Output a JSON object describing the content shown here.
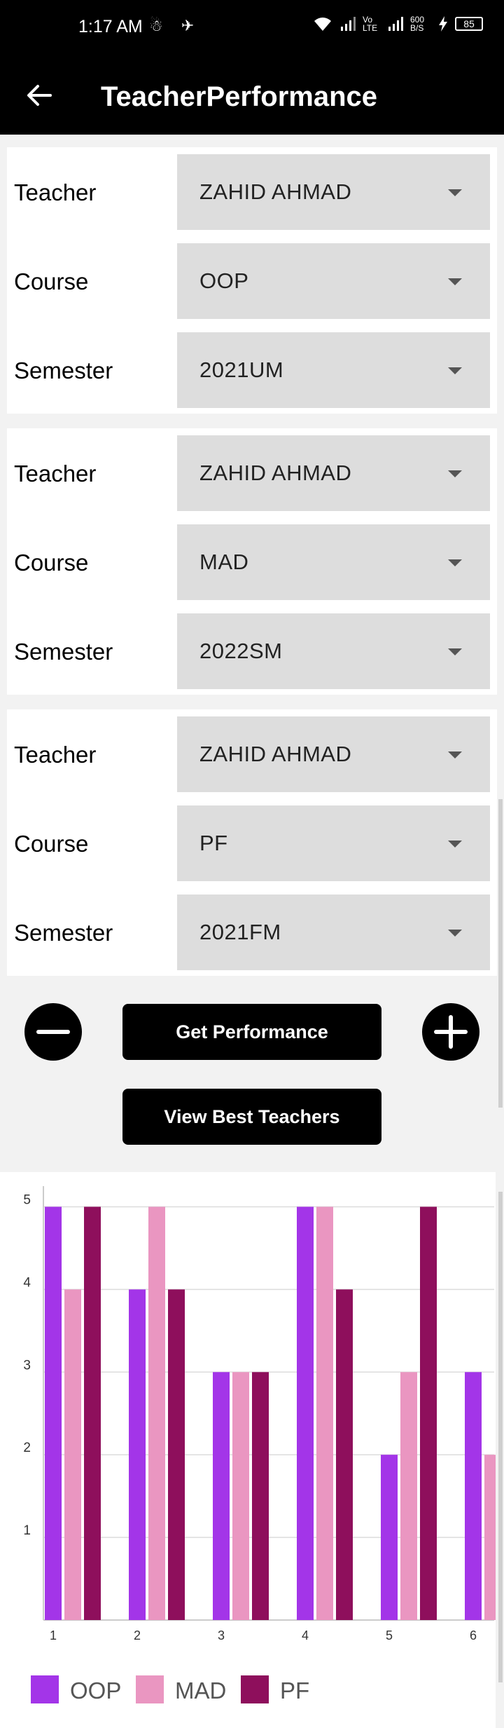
{
  "status_bar": {
    "time": "1:17 AM",
    "left_icons": "☃ ✈",
    "network": "Vo LTE",
    "speed": "600 B/S",
    "battery": "85"
  },
  "app_bar": {
    "title": "TeacherPerformance",
    "back_icon": "arrow-left-icon"
  },
  "cards": [
    {
      "teacher_label": "Teacher",
      "teacher": "ZAHID  AHMAD",
      "course_label": "Course",
      "course": "OOP",
      "semester_label": "Semester",
      "semester": "2021UM"
    },
    {
      "teacher_label": "Teacher",
      "teacher": "ZAHID  AHMAD",
      "course_label": "Course",
      "course": "MAD",
      "semester_label": "Semester",
      "semester": "2022SM"
    },
    {
      "teacher_label": "Teacher",
      "teacher": "ZAHID  AHMAD",
      "course_label": "Course",
      "course": "PF",
      "semester_label": "Semester",
      "semester": "2021FM"
    }
  ],
  "actions": {
    "remove_icon": "minus-circle-icon",
    "add_icon": "plus-circle-icon",
    "get_performance": "Get Performance",
    "view_best": "View Best Teachers"
  },
  "chart_data": {
    "type": "bar",
    "categories": [
      "1",
      "2",
      "3",
      "4",
      "5",
      "6"
    ],
    "series": [
      {
        "name": "OOP",
        "color": "#a335e8",
        "values": [
          5,
          4,
          3,
          5,
          2,
          3
        ]
      },
      {
        "name": "MAD",
        "color": "#ea96c1",
        "values": [
          4,
          5,
          3,
          5,
          3,
          2
        ]
      },
      {
        "name": "PF",
        "color": "#8e0f5c",
        "values": [
          5,
          4,
          3,
          4,
          5,
          null
        ]
      }
    ],
    "yticks": [
      "1",
      "2",
      "3",
      "4",
      "5"
    ],
    "ylim": [
      0,
      5.25
    ],
    "grid": true,
    "legend_position": "bottom"
  }
}
